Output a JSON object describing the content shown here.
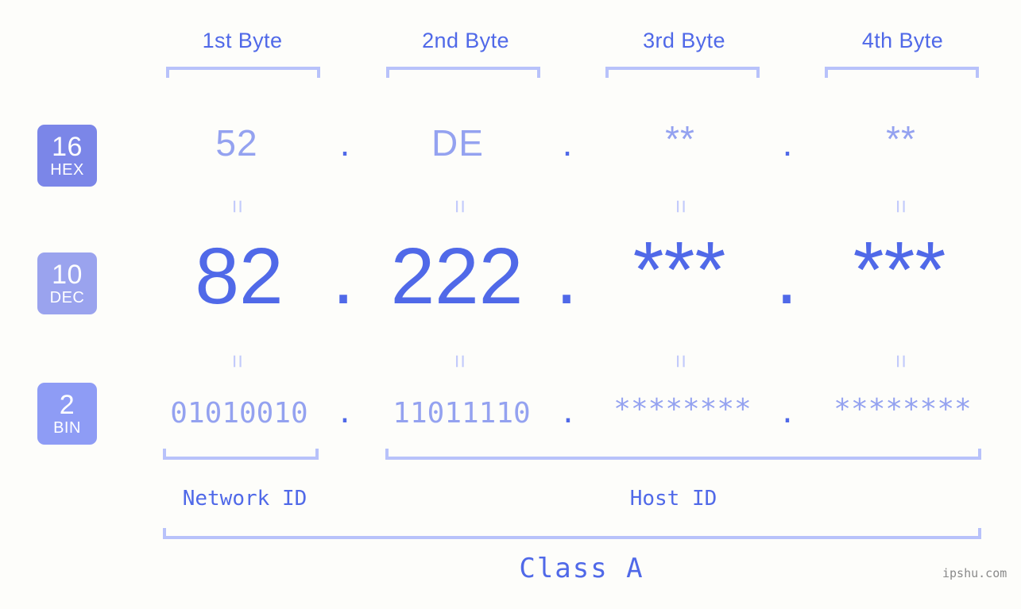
{
  "background_color": "#fdfdfa",
  "colors": {
    "accent_strong": "#5069e8",
    "accent_light": "#94a2f0",
    "bracket": "#b8c2fa",
    "equals": "#c3cbfb",
    "badge_hex_bg": "#7b86e8",
    "badge_dec_bg": "#9aa3ee",
    "badge_bin_bg": "#8e9cf5",
    "watermark": "#8a8a8a"
  },
  "byte_headers": [
    {
      "label": "1st Byte"
    },
    {
      "label": "2nd Byte"
    },
    {
      "label": "3rd Byte"
    },
    {
      "label": "4th Byte"
    }
  ],
  "bases": [
    {
      "number": "16",
      "abbr": "HEX"
    },
    {
      "number": "10",
      "abbr": "DEC"
    },
    {
      "number": "2",
      "abbr": "BIN"
    }
  ],
  "rows": {
    "hex": {
      "base_number": "16",
      "base_abbr": "HEX",
      "values": [
        "52",
        "DE",
        "**",
        "**"
      ]
    },
    "dec": {
      "base_number": "10",
      "base_abbr": "DEC",
      "values": [
        "82",
        "222",
        "***",
        "***"
      ]
    },
    "bin": {
      "base_number": "2",
      "base_abbr": "BIN",
      "values": [
        "01010010",
        "11011110",
        "********",
        "********"
      ]
    }
  },
  "separator": ".",
  "equals_mark": "=",
  "sections": [
    {
      "label": "Network ID"
    },
    {
      "label": "Host ID"
    }
  ],
  "class": {
    "label": "Class A"
  },
  "watermark": {
    "text": "ipshu.com"
  }
}
